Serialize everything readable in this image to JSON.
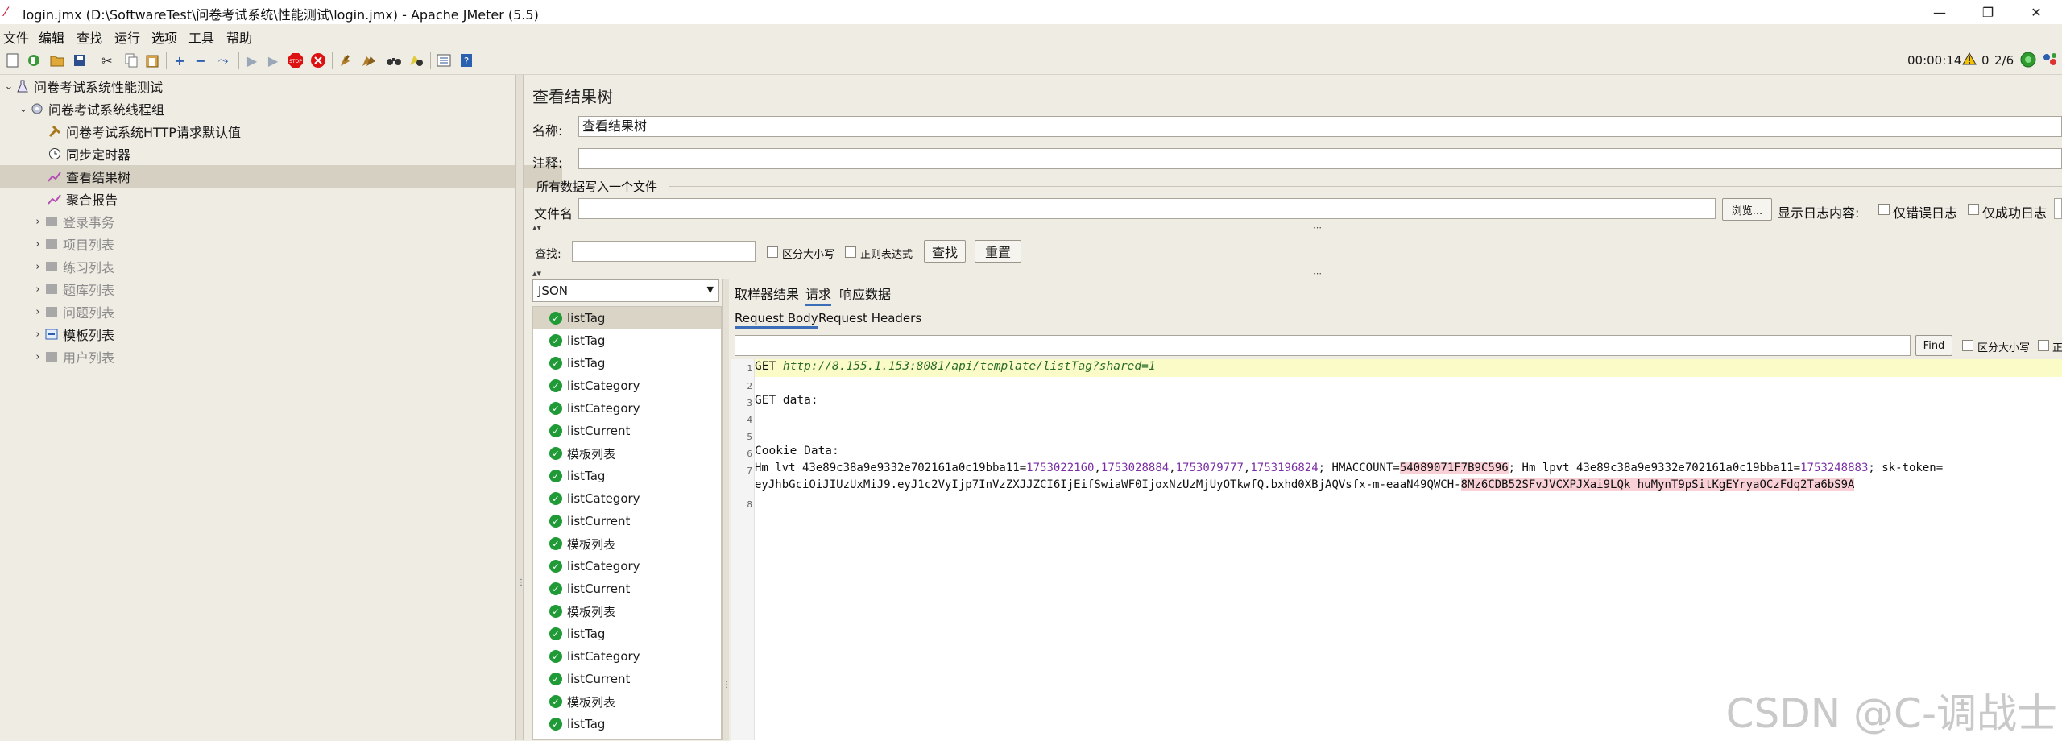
{
  "window": {
    "title": "login.jmx (D:\\SoftwareTest\\问卷考试系统\\性能测试\\login.jmx) - Apache JMeter (5.5)",
    "minimize": "—",
    "maximize": "❐",
    "close": "✕"
  },
  "menu": [
    "文件",
    "编辑",
    "查找",
    "运行",
    "选项",
    "工具",
    "帮助"
  ],
  "status": {
    "timer": "00:00:14",
    "warnings": "0",
    "threads": "2/6"
  },
  "tree": [
    {
      "label": "问卷考试系统性能测试",
      "enabled": true
    },
    {
      "label": "问卷考试系统线程组",
      "enabled": true
    },
    {
      "label": "问卷考试系统HTTP请求默认值",
      "enabled": true
    },
    {
      "label": "同步定时器",
      "enabled": true
    },
    {
      "label": "查看结果树",
      "enabled": true
    },
    {
      "label": "聚合报告",
      "enabled": true
    },
    {
      "label": "登录事务",
      "enabled": false
    },
    {
      "label": "项目列表",
      "enabled": false
    },
    {
      "label": "练习列表",
      "enabled": false
    },
    {
      "label": "题库列表",
      "enabled": false
    },
    {
      "label": "问题列表",
      "enabled": false
    },
    {
      "label": "模板列表",
      "enabled": true
    },
    {
      "label": "用户列表",
      "enabled": false
    }
  ],
  "panel": {
    "title": "查看结果树",
    "name_label": "名称:",
    "name_value": "查看结果树",
    "comment_label": "注释:",
    "file_section": "所有数据写入一个文件",
    "filename_label": "文件名",
    "browse": "浏览...",
    "log_content_label": "显示日志内容:",
    "errors_only": "仅错误日志",
    "success_only": "仅成功日志",
    "search_label": "查找:",
    "case_sensitive": "区分大小写",
    "regex": "正则表达式",
    "find_btn": "查找",
    "reset_btn": "重置"
  },
  "renderer": "JSON",
  "results": [
    "listTag",
    "listTag",
    "listTag",
    "listCategory",
    "listCategory",
    "listCurrent",
    "模板列表",
    "listTag",
    "listCategory",
    "listCurrent",
    "模板列表",
    "listCategory",
    "listCurrent",
    "模板列表",
    "listTag",
    "listCategory",
    "listCurrent",
    "模板列表",
    "listTag"
  ],
  "tabs": [
    "取样器结果",
    "请求",
    "响应数据"
  ],
  "subtabs": [
    "Request Body",
    "Request Headers"
  ],
  "editor_find": {
    "button": "Find",
    "case": "区分大小写",
    "more": "正"
  },
  "code": {
    "line_numbers": [
      "1",
      "2",
      "3",
      "4",
      "5",
      "6",
      "7",
      "",
      "8"
    ],
    "l1_method": "GET ",
    "l1_url": "http://8.155.1.153:8081/api/template/listTag?shared=1",
    "l3": "GET data:",
    "l6": "Cookie Data:",
    "l7_a": "Hm_lvt_43e89c38a9e9332e702161a0c19bba11=",
    "l7_n1": "1753022160",
    "l7_c1": ",",
    "l7_n2": "1753028884",
    "l7_c2": ",",
    "l7_n3": "1753079777",
    "l7_c3": ",",
    "l7_n4": "1753196824",
    "l7_b": "; HMACCOUNT=",
    "l7_h1": "54089071F7B9C596",
    "l7_c": "; Hm_lpvt_43e89c38a9e9332e702161a0c19bba11=",
    "l7_n5": "1753248883",
    "l7_d": "; sk-token=",
    "l7w_a": "eyJhbGciOiJIUzUxMiJ9.eyJ1c2VyIjp7InVzZXJJZCI6IjEifSwiaWF0IjoxNzUzMjUyOTkwfQ.bxhd0XBjAQVsfx-m-eaaN49QWCH-",
    "l7w_h": "8Mz6CDB52SFvJVCXPJXai9LQk_huMynT9pSitKgEYryaOCzFdq2Ta6bS9A"
  },
  "watermark": "CSDN @C-调战士"
}
